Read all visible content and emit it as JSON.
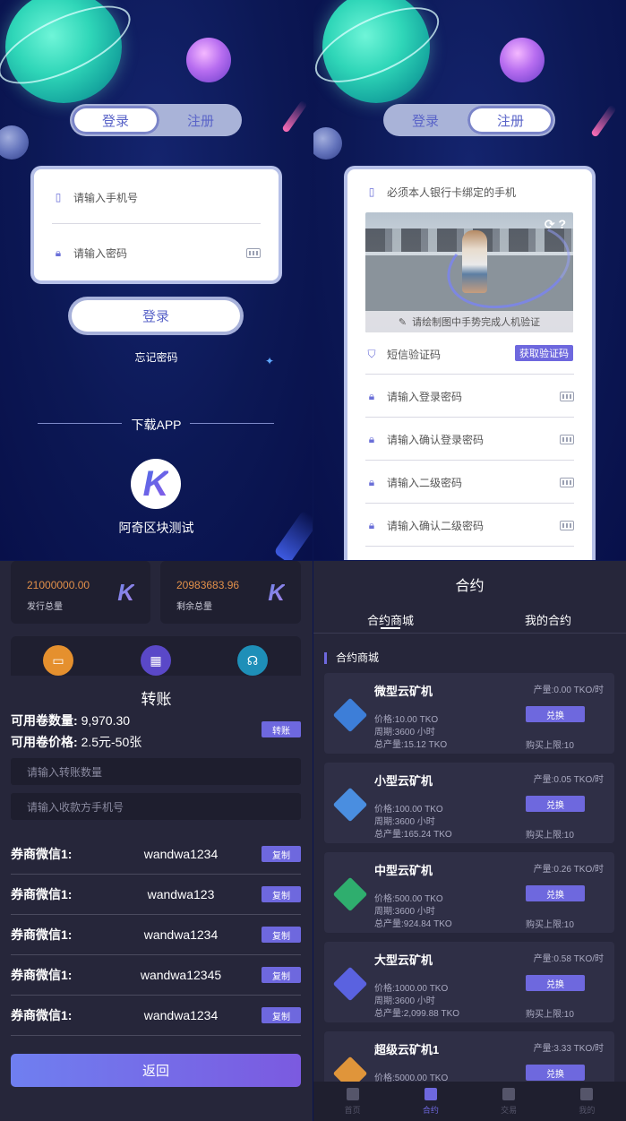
{
  "login": {
    "tab_login": "登录",
    "tab_register": "注册",
    "phone_placeholder": "请输入手机号",
    "password_placeholder": "请输入密码",
    "login_button": "登录",
    "forgot_password": "忘记密码",
    "download_app": "下载APP",
    "app_name": "阿奇区块测试",
    "app_logo_letter": "K"
  },
  "register": {
    "tab_login": "登录",
    "tab_register": "注册",
    "phone_hint": "必须本人银行卡绑定的手机",
    "captcha_hint": "请绘制图中手势完成人机验证",
    "captcha_tools": "⟳ ?",
    "sms_placeholder": "短信验证码",
    "sms_button": "获取验证码",
    "fields": [
      "请输入登录密码",
      "请输入确认登录密码",
      "请输入二级密码",
      "请输入确认二级密码"
    ]
  },
  "transfer": {
    "stats": [
      {
        "value": "21000000.00",
        "label": "发行总量",
        "logo": "K"
      },
      {
        "value": "20983683.96",
        "label": "剩余总量",
        "logo": "K"
      }
    ],
    "title": "转账",
    "available_qty_label": "可用卷数量:",
    "available_qty_value": "9,970.30",
    "available_price_label": "可用卷价格:",
    "available_price_value": "2.5元-50张",
    "transfer_button": "转账",
    "amount_placeholder": "请输入转账数量",
    "recipient_placeholder": "请输入收款方手机号",
    "wechat_rows": [
      {
        "label": "券商微信1:",
        "value": "wandwa1234",
        "button": "复制"
      },
      {
        "label": "券商微信1:",
        "value": "wandwa123",
        "button": "复制"
      },
      {
        "label": "券商微信1:",
        "value": "wandwa1234",
        "button": "复制"
      },
      {
        "label": "券商微信1:",
        "value": "wandwa12345",
        "button": "复制"
      },
      {
        "label": "券商微信1:",
        "value": "wandwa1234",
        "button": "复制"
      }
    ],
    "back_button": "返回"
  },
  "contract": {
    "title": "合约",
    "tabs": [
      "合约商城",
      "我的合约"
    ],
    "section": "合约商城",
    "miners": [
      {
        "name": "微型云矿机",
        "rate": "产量:0.00 TKO/时",
        "price": "价格:10.00 TKO",
        "period": "周期:3600 小时",
        "total": "总产量:15.12 TKO",
        "button": "兑换",
        "limit": "购买上限:10",
        "color": "#3d7ed8"
      },
      {
        "name": "小型云矿机",
        "rate": "产量:0.05 TKO/时",
        "price": "价格:100.00 TKO",
        "period": "周期:3600 小时",
        "total": "总产量:165.24 TKO",
        "button": "兑换",
        "limit": "购买上限:10",
        "color": "#4a8ee0"
      },
      {
        "name": "中型云矿机",
        "rate": "产量:0.26 TKO/时",
        "price": "价格:500.00 TKO",
        "period": "周期:3600 小时",
        "total": "总产量:924.84 TKO",
        "button": "兑换",
        "limit": "购买上限:10",
        "color": "#2fae6e"
      },
      {
        "name": "大型云矿机",
        "rate": "产量:0.58 TKO/时",
        "price": "价格:1000.00 TKO",
        "period": "周期:3600 小时",
        "total": "总产量:2,099.88 TKO",
        "button": "兑换",
        "limit": "购买上限:10",
        "color": "#5a62e0"
      },
      {
        "name": "超级云矿机1",
        "rate": "产量:3.33 TKO/时",
        "price": "价格:5000.00 TKO",
        "period": "",
        "total": "",
        "button": "兑换",
        "limit": "",
        "color": "#e0953a"
      }
    ],
    "tabbar": [
      "首页",
      "合约",
      "交易",
      "我的"
    ]
  }
}
